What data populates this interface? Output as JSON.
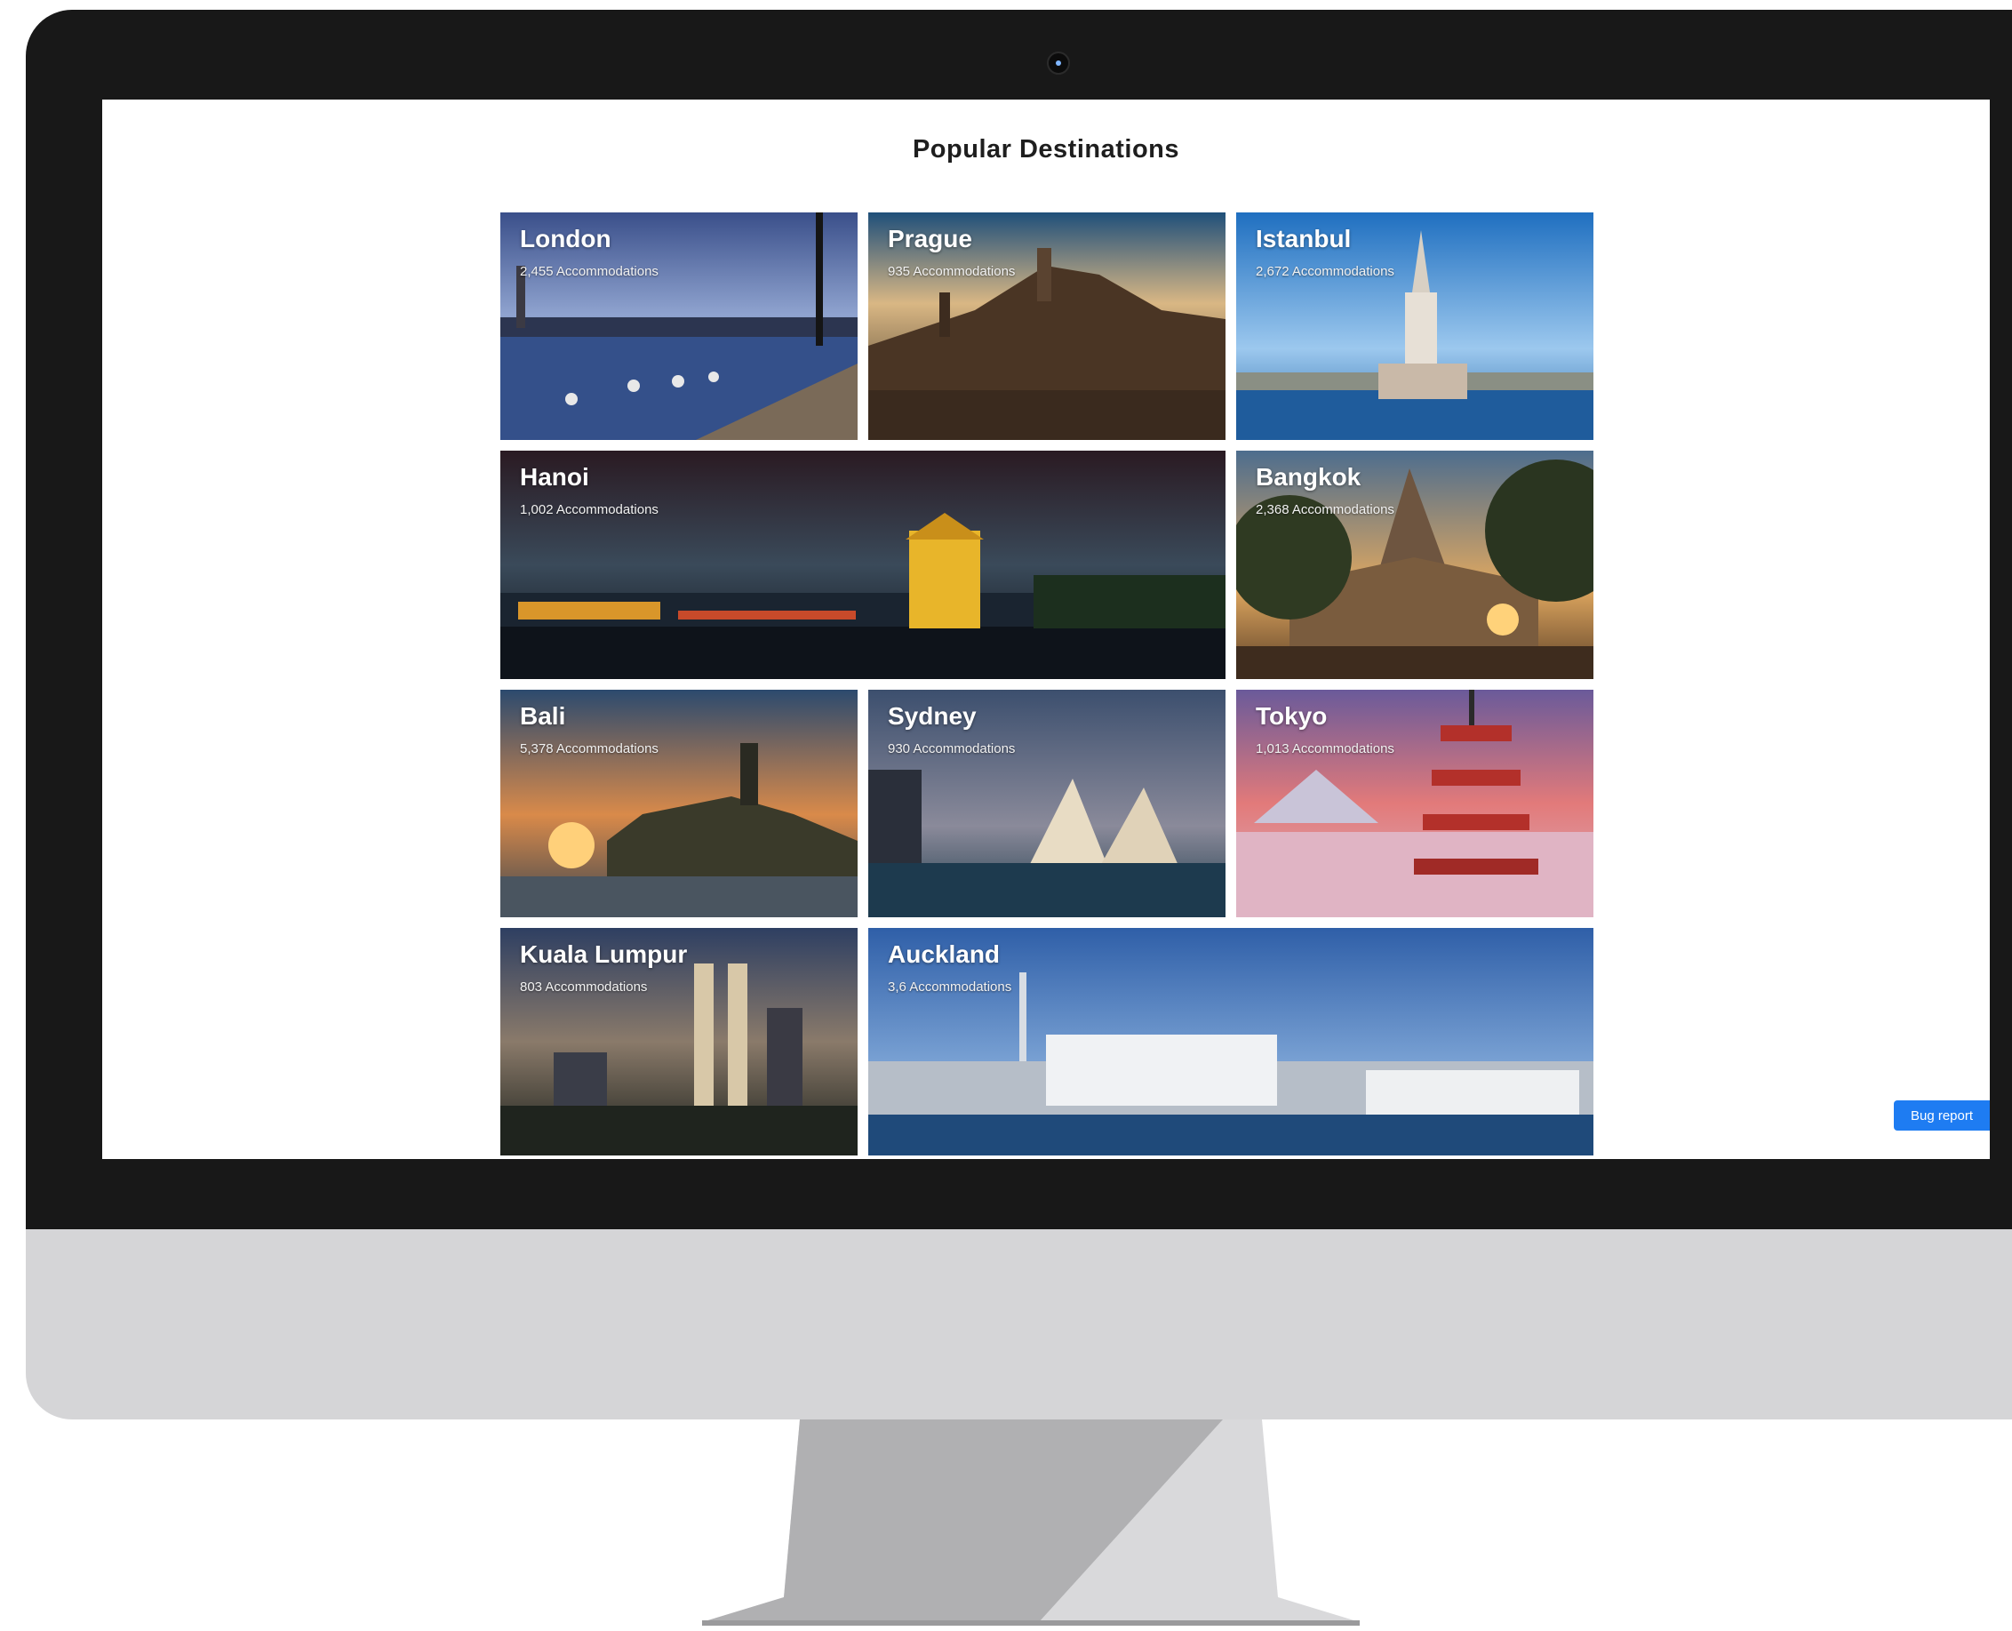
{
  "page": {
    "title": "Popular Destinations"
  },
  "destinations": [
    {
      "name": "London",
      "count": "2,455 Accommodations"
    },
    {
      "name": "Prague",
      "count": "935 Accommodations"
    },
    {
      "name": "Istanbul",
      "count": "2,672 Accommodations"
    },
    {
      "name": "Hanoi",
      "count": "1,002 Accommodations"
    },
    {
      "name": "Bangkok",
      "count": "2,368 Accommodations"
    },
    {
      "name": "Bali",
      "count": "5,378 Accommodations"
    },
    {
      "name": "Sydney",
      "count": "930 Accommodations"
    },
    {
      "name": "Tokyo",
      "count": "1,013 Accommodations"
    },
    {
      "name": "Kuala Lumpur",
      "count": "803 Accommodations"
    },
    {
      "name": "Auckland",
      "count": "3,6 Accommodations"
    }
  ],
  "bug_report": {
    "label": "Bug report"
  },
  "colors": {
    "bezel": "#181818",
    "chin": "#d5d5d7",
    "accent": "#1e7cf2"
  }
}
